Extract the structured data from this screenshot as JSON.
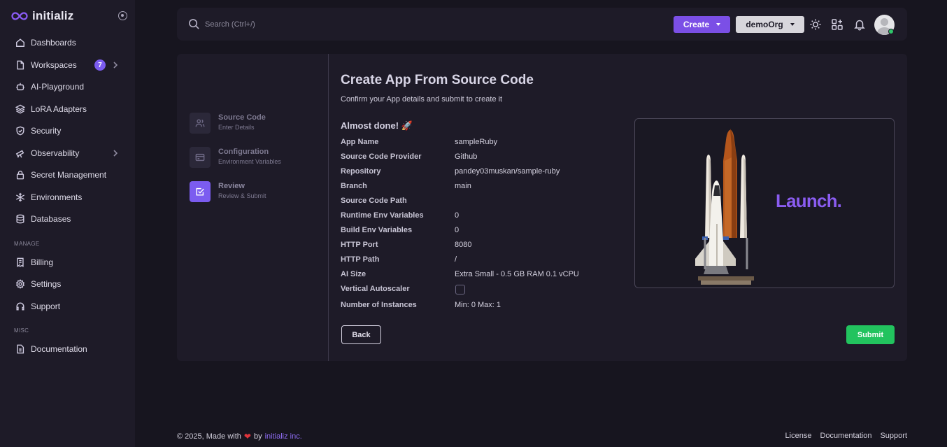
{
  "brand": {
    "name": "initializ",
    "accent": "#8b5cf6"
  },
  "sidebar": {
    "items": [
      {
        "label": "Dashboards",
        "icon": "home-icon"
      },
      {
        "label": "Workspaces",
        "icon": "file-icon",
        "badge": "7",
        "expandable": true
      },
      {
        "label": "AI-Playground",
        "icon": "robot-icon"
      },
      {
        "label": "LoRA Adapters",
        "icon": "layers-icon"
      },
      {
        "label": "Security",
        "icon": "shield-check-icon"
      },
      {
        "label": "Observability",
        "icon": "telescope-icon",
        "expandable": true
      },
      {
        "label": "Secret Management",
        "icon": "lock-icon"
      },
      {
        "label": "Environments",
        "icon": "snowflake-icon"
      },
      {
        "label": "Databases",
        "icon": "database-icon"
      }
    ],
    "manage_heading": "MANAGE",
    "manage_items": [
      {
        "label": "Billing",
        "icon": "receipt-icon"
      },
      {
        "label": "Settings",
        "icon": "gear-icon"
      },
      {
        "label": "Support",
        "icon": "headset-icon"
      }
    ],
    "misc_heading": "MISC",
    "misc_items": [
      {
        "label": "Documentation",
        "icon": "document-icon"
      }
    ]
  },
  "topbar": {
    "search_placeholder": "Search (Ctrl+/)",
    "create_label": "Create",
    "org_label": "demoOrg"
  },
  "steps": [
    {
      "title": "Source Code",
      "subtitle": "Enter Details",
      "icon": "users-icon",
      "active": false
    },
    {
      "title": "Configuration",
      "subtitle": "Environment Variables",
      "icon": "card-icon",
      "active": false
    },
    {
      "title": "Review",
      "subtitle": "Review & Submit",
      "icon": "check-square-icon",
      "active": true
    }
  ],
  "main": {
    "title": "Create App From Source Code",
    "subtitle": "Confirm your App details and submit to create it",
    "almost_done": "Almost done! 🚀",
    "details": [
      {
        "label": "App Name",
        "value": "sampleRuby"
      },
      {
        "label": "Source Code Provider",
        "value": "Github"
      },
      {
        "label": "Repository",
        "value": "pandey03muskan/sample-ruby"
      },
      {
        "label": "Branch",
        "value": "main"
      },
      {
        "label": "Source Code Path",
        "value": ""
      },
      {
        "label": "Runtime Env Variables",
        "value": "0"
      },
      {
        "label": "Build Env Variables",
        "value": "0"
      },
      {
        "label": "HTTP Port",
        "value": "8080"
      },
      {
        "label": "HTTP Path",
        "value": "/"
      },
      {
        "label": "AI Size",
        "value": "Extra Small - 0.5 GB RAM 0.1 vCPU"
      },
      {
        "label": "Vertical Autoscaler",
        "value": ""
      },
      {
        "label": "Number of Instances",
        "value": "Min: 0 Max: 1"
      }
    ],
    "vertical_autoscaler_checked": false,
    "back_label": "Back",
    "submit_label": "Submit",
    "launch_text": "Launch."
  },
  "footer": {
    "copyright": "© 2025, Made with",
    "by": "by",
    "company": "initializ inc.",
    "links": [
      "License",
      "Documentation",
      "Support"
    ]
  }
}
